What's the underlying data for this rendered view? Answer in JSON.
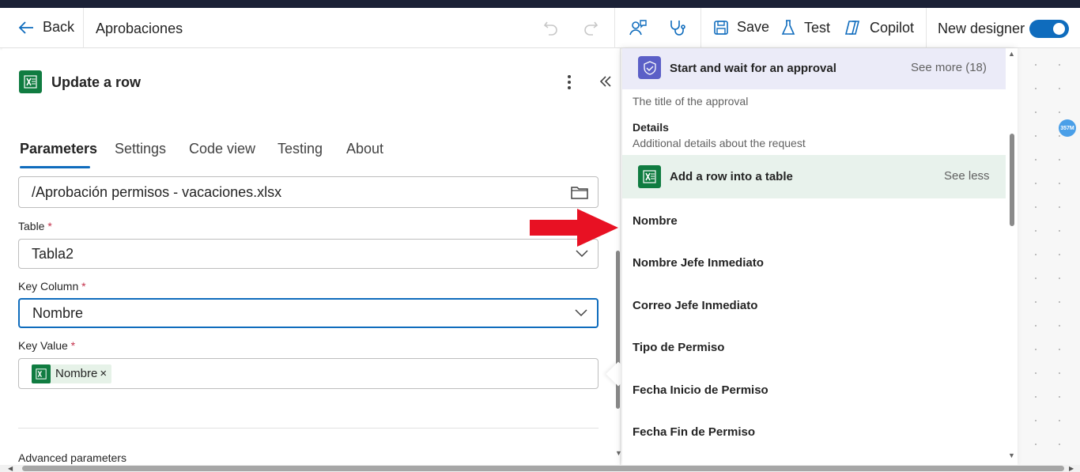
{
  "toolbar": {
    "back_label": "Back",
    "flow_name": "Aprobaciones",
    "save_label": "Save",
    "test_label": "Test",
    "copilot_label": "Copilot",
    "new_designer_label": "New designer",
    "new_designer_on": true
  },
  "panel": {
    "title": "Update a row",
    "tabs": [
      "Parameters",
      "Settings",
      "Code view",
      "Testing",
      "About"
    ],
    "active_tab": "Parameters",
    "file_value": "/Aprobación permisos - vacaciones.xlsx",
    "table_label": "Table",
    "table_value": "Tabla2",
    "key_column_label": "Key Column",
    "key_column_value": "Nombre",
    "key_value_label": "Key Value",
    "key_value_token": "Nombre",
    "token_close": "×",
    "required_mark": "*",
    "advanced_label": "Advanced parameters"
  },
  "dropdown": {
    "approval_section": {
      "title": "Start and wait for an approval",
      "see_more": "See more (18)",
      "items": [
        {
          "desc": "The title of the approval"
        },
        {
          "name": "Details",
          "desc": "Additional details about the request"
        }
      ]
    },
    "table_section": {
      "title": "Add a row into a table",
      "see_less": "See less",
      "items": [
        "Nombre",
        "Nombre Jefe Inmediato",
        "Correo Jefe Inmediato",
        "Tipo de Permiso",
        "Fecha Inicio de Permiso",
        "Fecha Fin de Permiso"
      ]
    }
  },
  "canvas": {
    "badge": "357M"
  },
  "colors": {
    "accent": "#0f6cbd",
    "excel_green": "#107c41",
    "approval_purple": "#5b5fc7",
    "arrow_red": "#e81123"
  }
}
